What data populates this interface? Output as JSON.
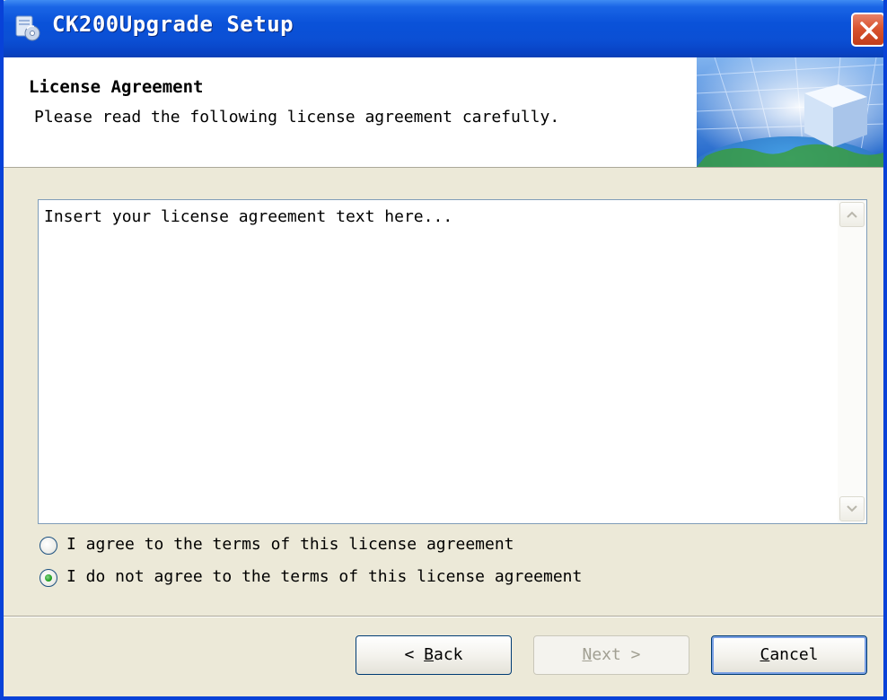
{
  "window": {
    "title": "CK200Upgrade Setup",
    "accent_color": "#0a52d9",
    "close_color": "#d9542f"
  },
  "header": {
    "title": "License Agreement",
    "subtitle": "Please read the following license agreement carefully."
  },
  "license": {
    "text": "Insert your license agreement text here..."
  },
  "options": [
    {
      "label": "I agree to the terms of this license agreement",
      "selected": false
    },
    {
      "label": "I do not agree to the terms of this license agreement",
      "selected": true
    }
  ],
  "buttons": {
    "back": {
      "arrow": "<",
      "key": "B",
      "rest": "ack",
      "enabled": true
    },
    "next": {
      "key": "N",
      "rest": "ext",
      "arrow": ">",
      "enabled": false
    },
    "cancel": {
      "key": "C",
      "rest": "ancel",
      "enabled": true
    }
  },
  "icons": {
    "title": "installer-disc-icon",
    "close": "close-x-icon",
    "scroll_up": "scroll-up-arrow-icon",
    "scroll_down": "scroll-down-arrow-icon",
    "header_graphic": "globe-cube-graphic"
  }
}
